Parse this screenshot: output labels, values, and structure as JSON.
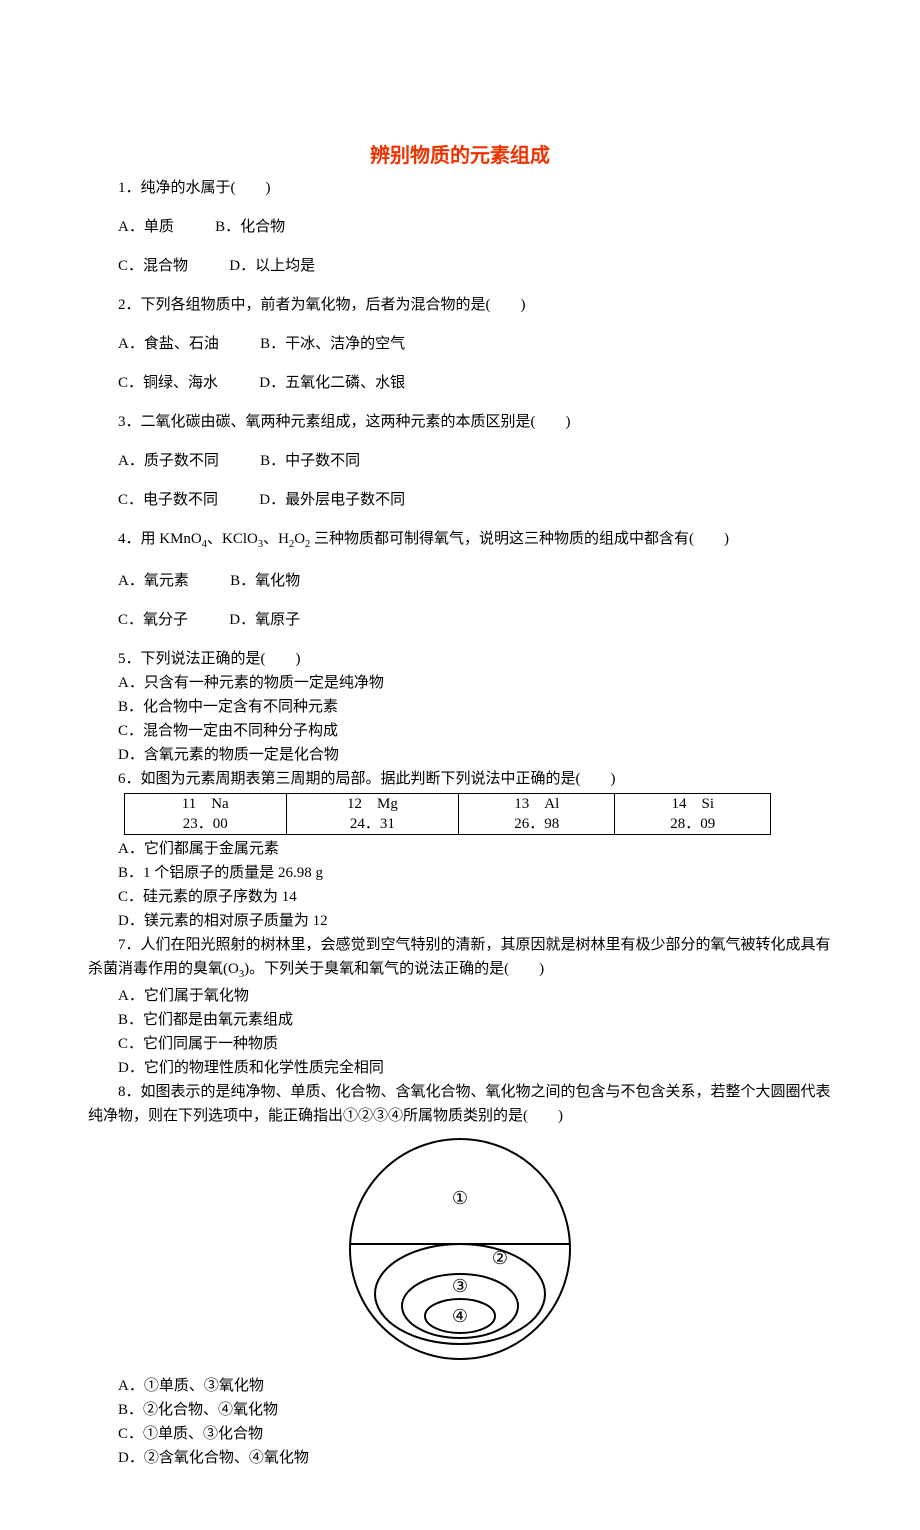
{
  "title": "辨别物质的元素组成",
  "q1": {
    "stem": "1．纯净的水属于(　　)",
    "A": "A．单质",
    "B": "B．化合物",
    "C": "C．混合物",
    "D": "D．以上均是"
  },
  "q2": {
    "stem": "2．下列各组物质中，前者为氧化物，后者为混合物的是(　　)",
    "A": "A．食盐、石油",
    "B": "B．干冰、洁净的空气",
    "C": "C．铜绿、海水",
    "D": "D．五氧化二磷、水银"
  },
  "q3": {
    "stem": "3．二氧化碳由碳、氧两种元素组成，这两种元素的本质区别是(　　)",
    "A": "A．质子数不同",
    "B": "B．中子数不同",
    "C": "C．电子数不同",
    "D": "D．最外层电子数不同"
  },
  "q4": {
    "stem_a": "4．用 KMnO",
    "stem_b": "、KClO",
    "stem_c": "、H",
    "stem_d": "O",
    "stem_e": " 三种物质都可制得氧气，说明这三种物质的组成中都含有(　　)",
    "A": "A．氧元素",
    "B": "B．氧化物",
    "C": "C．氧分子",
    "D": "D．氧原子"
  },
  "q5": {
    "stem": "5．下列说法正确的是(　　)",
    "A": "A．只含有一种元素的物质一定是纯净物",
    "B": "B．化合物中一定含有不同种元素",
    "C": "C．混合物一定由不同种分子构成",
    "D": "D．含氧元素的物质一定是化合物"
  },
  "q6": {
    "stem": "6．如图为元素周期表第三周期的局部。据此判断下列说法中正确的是(　　)",
    "cells": {
      "c1a": "11　Na",
      "c1b": "23．00",
      "c2a": "12　Mg",
      "c2b": "24．31",
      "c3a": "13　Al",
      "c3b": "26．98",
      "c4a": "14　Si",
      "c4b": "28．09"
    },
    "A": "A．它们都属于金属元素",
    "B": "B．1 个铝原子的质量是 26.98 g",
    "C": "C．硅元素的原子序数为 14",
    "D": "D．镁元素的相对原子质量为 12"
  },
  "q7": {
    "stem_a": "7．人们在阳光照射的树林里，会感觉到空气特别的清新，其原因就是树林里有极少部分的氧气被转化成具有杀菌消毒作用的臭氧(O",
    "stem_b": ")。下列关于臭氧和氧气的说法正确的是(　　)",
    "A": "A．它们属于氧化物",
    "B": "B．它们都是由氧元素组成",
    "C": "C．它们同属于一种物质",
    "D": "D．它们的物理性质和化学性质完全相同"
  },
  "q8": {
    "stem": "8．如图表示的是纯净物、单质、化合物、含氧化合物、氧化物之间的包含与不包含关系，若整个大圆圈代表纯净物，则在下列选项中，能正确指出①②③④所属物质类别的是(　　)",
    "labels": {
      "l1": "①",
      "l2": "②",
      "l3": "③",
      "l4": "④"
    },
    "A": "A．①单质、③氧化物",
    "B": "B．②化合物、④氧化物",
    "C": "C．①单质、③化合物",
    "D": "D．②含氧化合物、④氧化物"
  }
}
